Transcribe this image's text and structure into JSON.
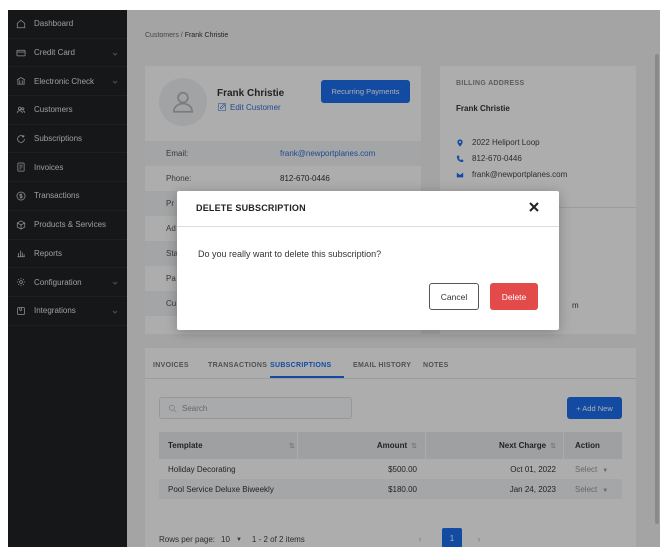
{
  "sidebar": {
    "items": [
      {
        "label": "Dashboard",
        "icon": "home-icon",
        "has_chevron": false
      },
      {
        "label": "Credit Card",
        "icon": "credit-card-icon",
        "has_chevron": true
      },
      {
        "label": "Electronic Check",
        "icon": "bank-icon",
        "has_chevron": true
      },
      {
        "label": "Customers",
        "icon": "users-icon",
        "has_chevron": false
      },
      {
        "label": "Subscriptions",
        "icon": "refresh-icon",
        "has_chevron": false
      },
      {
        "label": "Invoices",
        "icon": "invoice-icon",
        "has_chevron": false
      },
      {
        "label": "Transactions",
        "icon": "dollar-circle-icon",
        "has_chevron": false
      },
      {
        "label": "Products & Services",
        "icon": "box-icon",
        "has_chevron": false
      },
      {
        "label": "Reports",
        "icon": "bar-chart-icon",
        "has_chevron": false
      },
      {
        "label": "Configuration",
        "icon": "gear-icon",
        "has_chevron": true
      },
      {
        "label": "Integrations",
        "icon": "puzzle-icon",
        "has_chevron": true
      }
    ]
  },
  "breadcrumb": {
    "parent": "Customers",
    "separator": " / ",
    "current": "Frank Christie"
  },
  "profile": {
    "name": "Frank Christie",
    "edit_label": "Edit Customer",
    "recurring_label": "Recurring Payments",
    "rows": [
      {
        "label": "Email:",
        "value": "frank@newportplanes.com",
        "link": true
      },
      {
        "label": "Phone:",
        "value": "812-670-0446",
        "link": false
      },
      {
        "label": "Pr",
        "value": "",
        "link": false
      },
      {
        "label": "Ad",
        "value": "",
        "link": false
      },
      {
        "label": "Sta",
        "value": "",
        "link": false
      },
      {
        "label": "Pa",
        "value": "",
        "link": false
      },
      {
        "label": "Cu",
        "value": "",
        "link": false
      }
    ]
  },
  "billing": {
    "title": "BILLING ADDRESS",
    "name": "Frank Christie",
    "address": "2022 Heliport Loop",
    "phone": "812-670-0446",
    "email": "frank@newportplanes.com",
    "tail": "m"
  },
  "tabs": [
    {
      "label": "INVOICES",
      "active": false
    },
    {
      "label": "TRANSACTIONS",
      "active": false
    },
    {
      "label": "SUBSCRIPTIONS",
      "active": true
    },
    {
      "label": "EMAIL HISTORY",
      "active": false
    },
    {
      "label": "NOTES",
      "active": false
    }
  ],
  "subscriptions": {
    "search_placeholder": "Search",
    "add_label": "+ Add New",
    "columns": {
      "template": "Template",
      "amount": "Amount",
      "next_charge": "Next Charge",
      "action": "Action"
    },
    "sort_glyph": "⇅",
    "rows": [
      {
        "template": "Holiday Decorating",
        "amount": "$500.00",
        "next_charge": "Oct 01, 2022",
        "action": "Select"
      },
      {
        "template": "Pool Service Deluxe Biweekly",
        "amount": "$180.00",
        "next_charge": "Jan 24, 2023",
        "action": "Select"
      }
    ],
    "pager": {
      "rows_per_page_label": "Rows per page:",
      "rows_per_page": "10",
      "range": "1 - 2 of 2 items",
      "current_page": "1"
    }
  },
  "modal": {
    "title": "DELETE SUBSCRIPTION",
    "message": "Do you really want to delete this subscription?",
    "cancel_label": "Cancel",
    "delete_label": "Delete"
  },
  "colors": {
    "primary": "#1c6ff0",
    "danger": "#e34a4a",
    "sidebar": "#1f2225"
  }
}
